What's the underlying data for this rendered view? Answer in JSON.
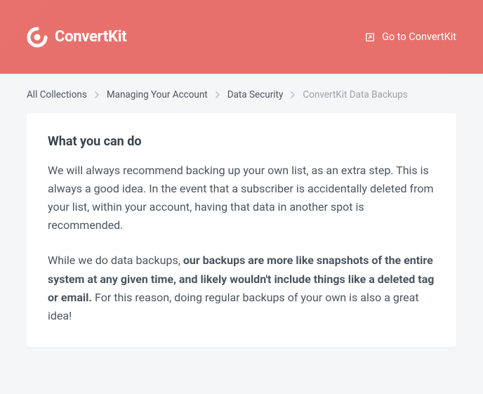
{
  "header": {
    "logo_text": "ConvertKit",
    "link_label": "Go to ConvertKit"
  },
  "breadcrumb": {
    "items": [
      "All Collections",
      "Managing Your Account",
      "Data Security"
    ],
    "current": "ConvertKit Data Backups"
  },
  "content": {
    "section_title": "What you can do",
    "paragraph1": "We will always recommend backing up your own list, as an extra step. This is always a good idea. In the event that a subscriber is accidentally deleted from your list, within your account, having that data in another spot is recommended.",
    "paragraph2_lead": "While we do data backups, ",
    "paragraph2_bold": "our backups are more like snapshots of the entire system at any given time, and likely wouldn't include things like a deleted tag or email.",
    "paragraph2_tail": " For this reason, doing regular backups of your own is also a great idea!"
  }
}
